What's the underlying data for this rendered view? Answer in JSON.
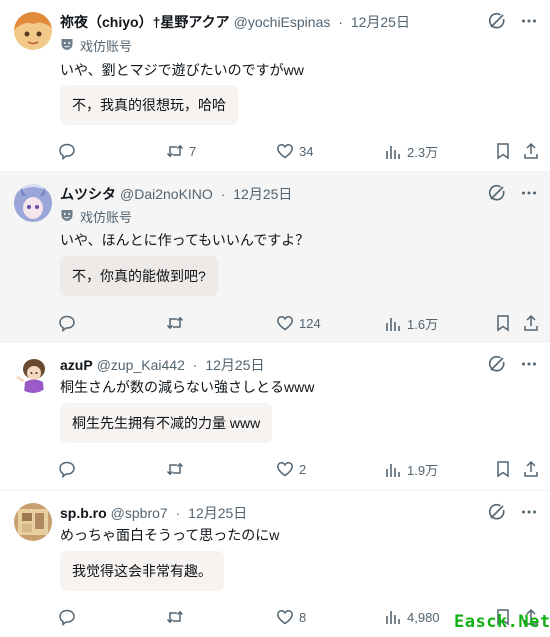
{
  "posts": [
    {
      "name": "祢夜（chiyo）†星野アクア",
      "handle": "@yochiEspinas",
      "sep": "·",
      "date": "12月25日",
      "provenance": "戏仿账号",
      "text": "いや、劉とマジで遊びたいのですがww",
      "translation": "不，我真的很想玩，哈哈",
      "replies": "",
      "reposts": "7",
      "likes": "34",
      "views": "2.3万"
    },
    {
      "name": "ムツシタ",
      "handle": "@Dai2noKINO",
      "sep": "·",
      "date": "12月25日",
      "provenance": "戏仿账号",
      "text": "いや、ほんとに作ってもいいんですよ？",
      "translation": "不，你真的能做到吧?",
      "replies": "",
      "reposts": "",
      "likes": "124",
      "views": "1.6万"
    },
    {
      "name": "azuP",
      "handle": "@zup_Kai442",
      "sep": "·",
      "date": "12月25日",
      "provenance": "",
      "text": "桐生さんが数の減らない強さしとるwww",
      "translation": "桐生先生拥有不减的力量 www",
      "replies": "",
      "reposts": "",
      "likes": "2",
      "views": "1.9万"
    },
    {
      "name": "sp.b.ro",
      "handle": "@spbro7",
      "sep": "·",
      "date": "12月25日",
      "provenance": "",
      "text": "めっちゃ面白そうって思ったのにw",
      "translation": "我觉得这会非常有趣。",
      "replies": "",
      "reposts": "",
      "likes": "8",
      "views": "4,980"
    }
  ],
  "watermark": "Easck.Net",
  "icons": {
    "provenance": "parody-mask-icon",
    "grok": "grok-icon",
    "more": "more-icon",
    "reply": "reply-icon",
    "repost": "repost-icon",
    "like": "heart-icon",
    "views": "views-chart-icon",
    "bookmark": "bookmark-icon",
    "share": "share-icon"
  },
  "colors": {
    "text": "#0f1419",
    "muted": "#536471",
    "highlight_bg": "#f5f5f5",
    "translation_bg": "#f7f3f1",
    "watermark": "#12b112"
  }
}
